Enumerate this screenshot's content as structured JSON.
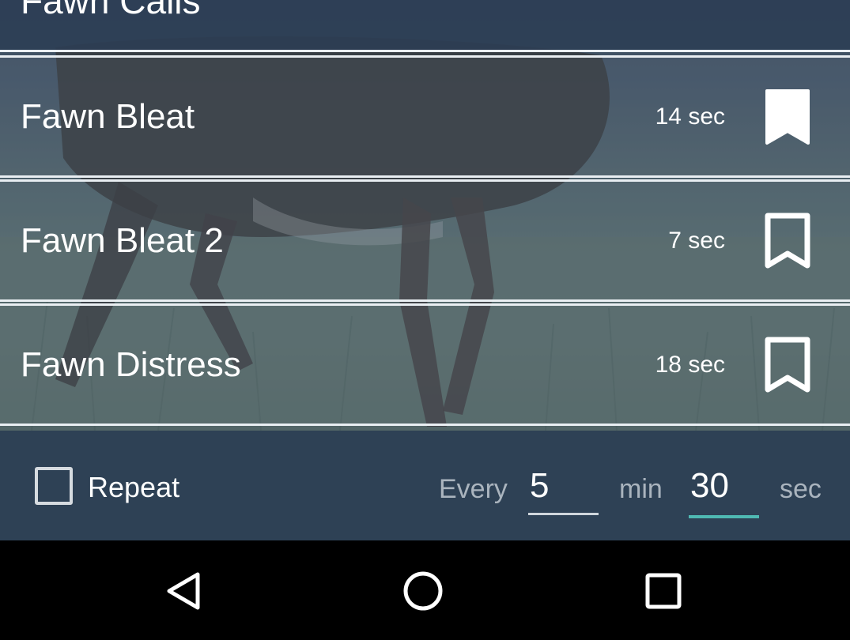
{
  "header": {
    "title": "Fawn Calls"
  },
  "calls": [
    {
      "name": "Fawn Bleat",
      "duration": "14 sec",
      "bookmarked": true
    },
    {
      "name": "Fawn Bleat 2",
      "duration": "7 sec",
      "bookmarked": false
    },
    {
      "name": "Fawn Distress",
      "duration": "18 sec",
      "bookmarked": false
    }
  ],
  "repeat": {
    "label": "Repeat",
    "checked": false,
    "every_label": "Every",
    "minutes_value": "5",
    "min_label": "min",
    "seconds_value": "30",
    "sec_label": "sec"
  },
  "navbar": {
    "back_icon": "back-triangle-icon",
    "home_icon": "home-circle-icon",
    "recents_icon": "recents-square-icon"
  },
  "colors": {
    "panel": "#2e4155",
    "accent": "#4fb9b3",
    "divider": "#e9eef2"
  }
}
